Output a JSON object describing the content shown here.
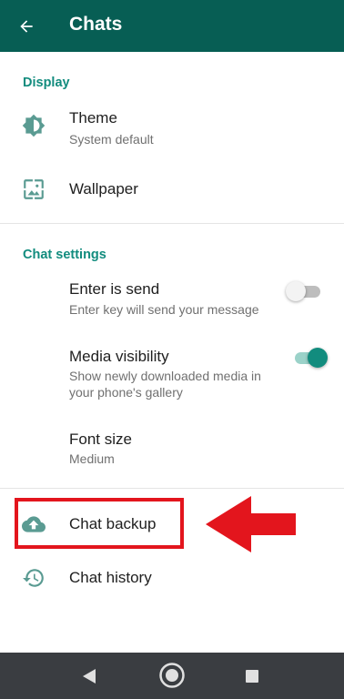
{
  "appbar": {
    "title": "Chats"
  },
  "sections": {
    "display": "Display",
    "chat_settings": "Chat settings"
  },
  "theme": {
    "title": "Theme",
    "subtitle": "System default"
  },
  "wallpaper": {
    "title": "Wallpaper"
  },
  "enter_is_send": {
    "title": "Enter is send",
    "subtitle": "Enter key will send your message",
    "enabled": false
  },
  "media_visibility": {
    "title": "Media visibility",
    "subtitle_line1": "Show newly downloaded media in",
    "subtitle_line2": "your phone's gallery",
    "enabled": true
  },
  "font_size": {
    "title": "Font size",
    "subtitle": "Medium"
  },
  "chat_backup": {
    "title": "Chat backup"
  },
  "chat_history": {
    "title": "Chat history"
  },
  "colors": {
    "appbar": "#075e54",
    "accent": "#128c7e",
    "highlight": "#e3151d"
  },
  "icons": {
    "back": "arrow-left-icon",
    "theme": "brightness-icon",
    "wallpaper": "wallpaper-icon",
    "backup": "cloud-upload-icon",
    "history": "history-icon",
    "nav_back": "triangle-back-icon",
    "nav_home": "circle-home-icon",
    "nav_recents": "square-recents-icon"
  }
}
